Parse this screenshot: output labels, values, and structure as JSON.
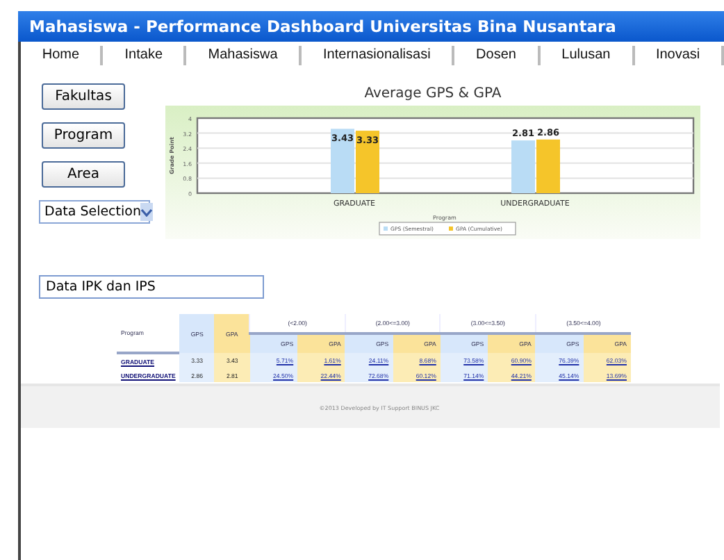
{
  "window": {
    "title": "Mahasiswa - Performance Dashboard Universitas Bina Nusantara"
  },
  "tabs": [
    {
      "label": "Home"
    },
    {
      "label": "Intake"
    },
    {
      "label": "Mahasiswa"
    },
    {
      "label": "Internasionalisasi"
    },
    {
      "label": "Dosen"
    },
    {
      "label": "Lulusan"
    },
    {
      "label": "Inovasi"
    }
  ],
  "side_buttons": [
    "Fakultas",
    "Program",
    "Area"
  ],
  "data_selection": {
    "value": "Data Selection"
  },
  "chart": {
    "chart_data": {
      "type": "bar",
      "title": "Average GPS & GPA",
      "xlabel": "Program",
      "ylabel": "Grade Point",
      "categories": [
        "GRADUATE",
        "UNDERGRADUATE"
      ],
      "series": [
        {
          "name": "GPS (Semestral)",
          "color": "#b9dcf5",
          "values": [
            3.43,
            2.81
          ]
        },
        {
          "name": "GPA (Cumulative)",
          "color": "#f5c52a",
          "values": [
            3.33,
            2.86
          ]
        }
      ],
      "ylim": [
        0,
        4
      ],
      "yticks": [
        0,
        0.8,
        1.6,
        2.4,
        3.2,
        4
      ],
      "data_labels": true,
      "grid": true,
      "legend": true
    }
  },
  "section_field": {
    "value": "Data IPK dan IPS"
  },
  "table": {
    "head": {
      "program": "Program",
      "gps": "GPS",
      "gpa": "GPA",
      "ranges": [
        {
          "label": "(<2.00)",
          "sub": [
            "GPS",
            "GPA"
          ]
        },
        {
          "label": "(2.00<=3.00)",
          "sub": [
            "GPS",
            "GPA"
          ]
        },
        {
          "label": "(3.00<=3.50)",
          "sub": [
            "GPS",
            "GPA"
          ]
        },
        {
          "label": "(3.50<=4.00)",
          "sub": [
            "GPS",
            "GPA"
          ]
        }
      ]
    },
    "rows": [
      {
        "program": "GRADUATE",
        "gps": "3.33",
        "gpa": "3.43",
        "cells": [
          "5.71%",
          "1.61%",
          "24.11%",
          "8.68%",
          "73.58%",
          "60.90%",
          "76.39%",
          "62.03%"
        ]
      },
      {
        "program": "UNDERGRADUATE",
        "gps": "2.86",
        "gpa": "2.81",
        "cells": [
          "24.50%",
          "22.44%",
          "72.68%",
          "60.12%",
          "71.14%",
          "44.21%",
          "45.14%",
          "13.69%"
        ]
      }
    ]
  },
  "footer": "©2013 Developed by IT Support BINUS JKC"
}
